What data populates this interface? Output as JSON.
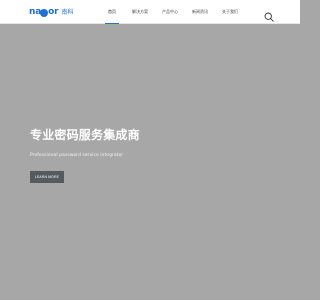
{
  "header": {
    "logo": {
      "text_pre": "na",
      "text_post": "or",
      "cn": "南科"
    },
    "nav": [
      {
        "label": "首页",
        "active": true
      },
      {
        "label": "解决方案",
        "active": false
      },
      {
        "label": "产品中心",
        "active": false
      },
      {
        "label": "新闻资讯",
        "active": false
      },
      {
        "label": "关于我们",
        "active": false
      }
    ],
    "search_icon": "search-icon"
  },
  "hero": {
    "title": "专业密码服务集成商",
    "subtitle": "Professional password service integrator",
    "button_label": "LEARN MORE"
  },
  "colors": {
    "brand": "#1f6fd6",
    "hero_bg": "#a7a7a7",
    "button_bg": "#555a5e"
  }
}
